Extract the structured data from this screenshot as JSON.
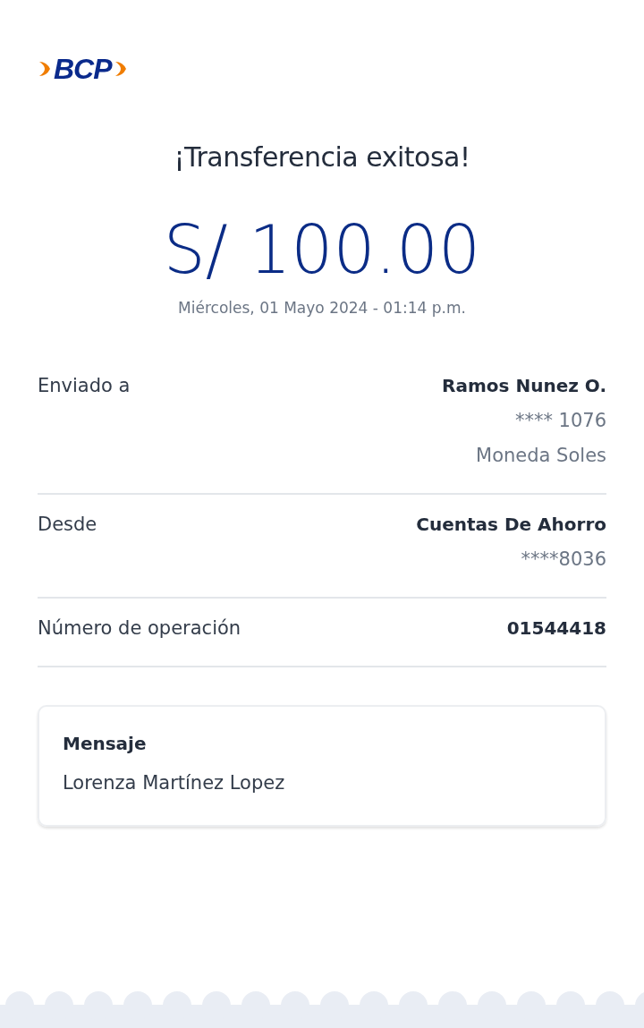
{
  "logo": {
    "text": "BCP"
  },
  "title": "¡Transferencia exitosa!",
  "amount": "S/ 100.00",
  "datetime": "Miércoles, 01 Mayo 2024 - 01:14 p.m.",
  "details": [
    {
      "label": "Enviado a",
      "values": [
        "Ramos Nunez O.",
        "**** 1076",
        "Moneda Soles"
      ]
    },
    {
      "label": "Desde",
      "values": [
        "Cuentas De Ahorro",
        "****8036"
      ]
    },
    {
      "label": "Número de operación",
      "values": [
        "01544418"
      ]
    }
  ],
  "message": {
    "label": "Mensaje",
    "text": "Lorenza Martínez Lopez"
  }
}
